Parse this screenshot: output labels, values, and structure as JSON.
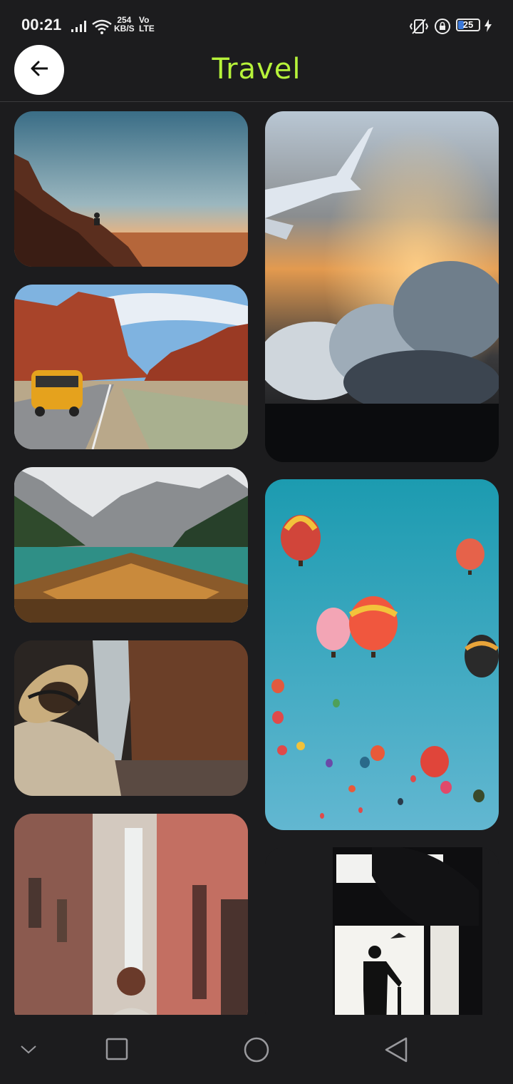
{
  "status_bar": {
    "time": "00:21",
    "net_speed_value": "254",
    "net_speed_unit": "KB/S",
    "volte_top": "Vo",
    "volte_bottom": "LTE",
    "battery_level": "25"
  },
  "header": {
    "title": "Travel",
    "title_color": "#b6f23a"
  },
  "gallery": {
    "photos": [
      {
        "subject": "desert-cliff-sunset"
      },
      {
        "subject": "yellow-van-red-rocks"
      },
      {
        "subject": "boat-mountain-lake"
      },
      {
        "subject": "hat-traveler-canyon"
      },
      {
        "subject": "narrow-street-walker"
      },
      {
        "subject": "airplane-wing-clouds"
      },
      {
        "subject": "hot-air-balloons"
      },
      {
        "subject": "window-silhouette-plane"
      }
    ]
  },
  "nav": {
    "icons": [
      "chevron-down-icon",
      "recents-square-icon",
      "home-circle-icon",
      "back-triangle-icon"
    ]
  }
}
